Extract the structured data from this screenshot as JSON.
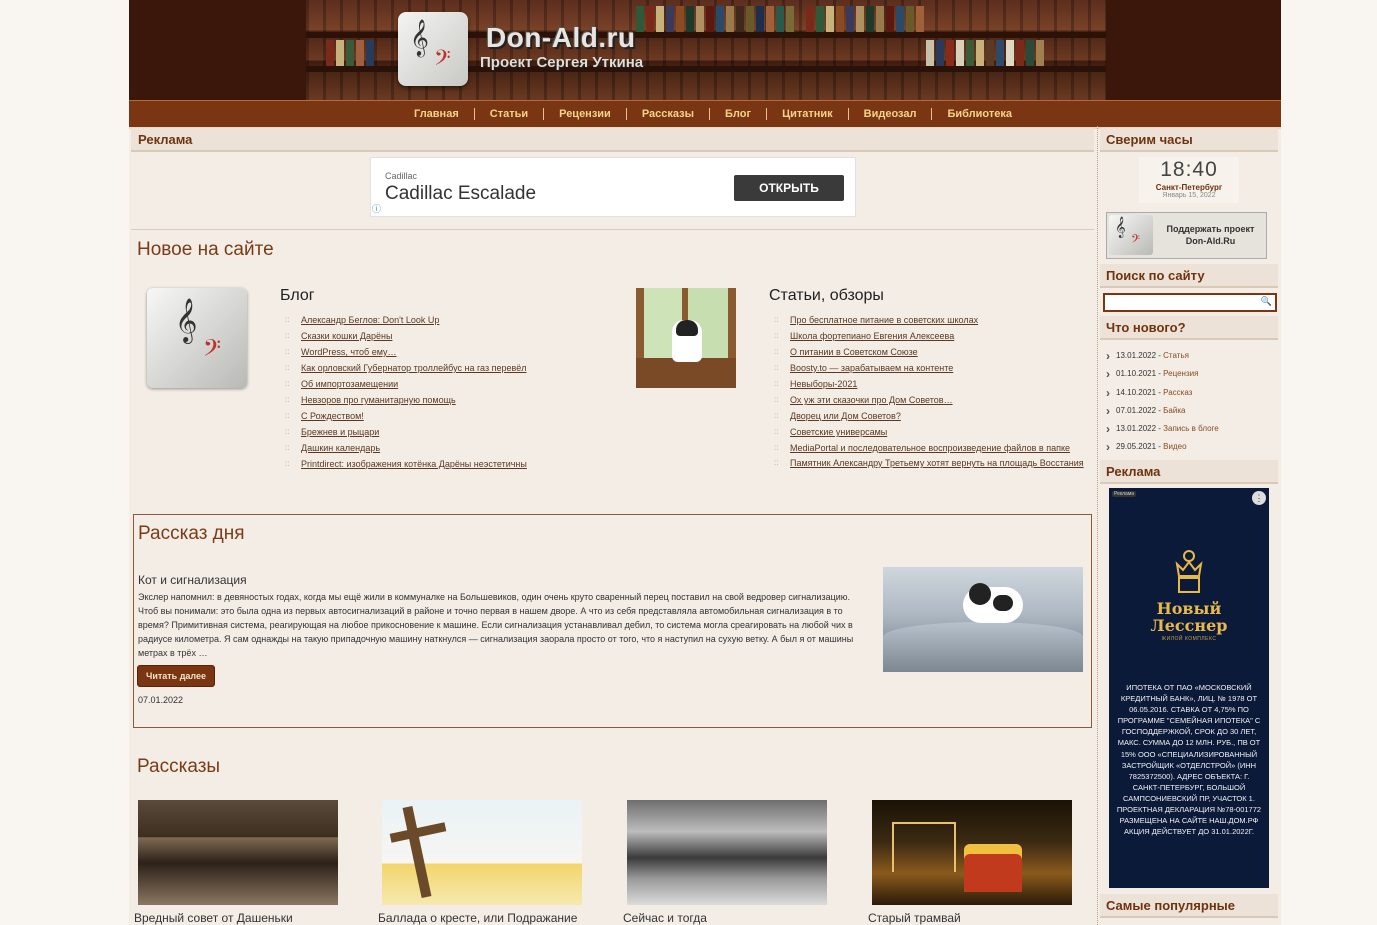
{
  "header": {
    "site_title": "Don-Ald.ru",
    "site_subtitle": "Проект Сергея Уткина"
  },
  "nav": [
    "Главная",
    "Статьи",
    "Рецензии",
    "Рассказы",
    "Блог",
    "Цитатник",
    "Видеозал",
    "Библиотека"
  ],
  "ad_top": {
    "heading": "Реклама",
    "brand": "Cadillac",
    "title": "Cadillac Escalade",
    "button": "ОТКРЫТЬ"
  },
  "new_section": {
    "title": "Новое на сайте",
    "blog": {
      "title": "Блог",
      "items": [
        "Александр Беглов: Don't Look Up",
        "Сказки кошки Дарёны",
        "WordPress, чтоб ему…",
        "Как орловский Губернатор троллейбус на газ перевёл",
        "Об импортозамещении",
        "Невзоров про гуманитарную помощь",
        "С Рождеством!",
        "Брежнев и рыцари",
        "Дашкин календарь",
        "Printdirect: изображения котёнка Дарёны неэстетичны"
      ]
    },
    "articles": {
      "title": "Статьи, обзоры",
      "items": [
        "Про бесплатное питание в советских школах",
        "Школа фортепиано Евгения Алексеева",
        "О питании в Советском Союзе",
        "Boosty.to — зарабатываем на контенте",
        "Невыборы-2021",
        "Ох уж эти сказочки про Дом Советов…",
        "Дворец или Дом Советов?",
        "Советские универсамы",
        "MediaPortal и последовательное воспроизведение файлов в папке",
        "Памятник Александру Третьему хотят вернуть на площадь Восстания"
      ]
    }
  },
  "story_day": {
    "section_title": "Рассказ дня",
    "title": "Кот и сигнализация",
    "text": "Экслер напомнил: в девяностых годах, когда мы ещё жили в коммуналке на Большевиков, один очень круто сваренный перец поставил на свой ведровер сигнализацию. Чтоб вы понимали: это была одна из первых автосигнализаций в районе и точно первая в нашем дворе. А что из себя представляла автомобильная сигнализация в то время? Примитивная система, реагирующая на любое прикосновение к машине. Если сигнализация устанавливал дебил, то система могла среагировать на любой чих в радиусе километра. Я сам однажды на такую припадочную машину наткнулся — сигнализация заорала просто от того, что я наступил на сухую ветку. А был я от машины метрах в трёх …",
    "button": "Читать далее",
    "date": "07.01.2022"
  },
  "stories": {
    "title": "Рассказы",
    "items": [
      "Вредный совет от Дашеньки",
      "Баллада о кресте, или Подражание",
      "Сейчас и тогда",
      "Старый трамвай"
    ]
  },
  "sidebar": {
    "clock_heading": "Сверим часы",
    "clock_time": "18:40",
    "clock_city": "Санкт-Петербург",
    "clock_date": "Январь 15, 2022",
    "donate": "Поддержать проект Don-Ald.Ru",
    "search_heading": "Поиск по сайту",
    "search_value": "",
    "whats_new_heading": "Что нового?",
    "whats_new": [
      {
        "date": "13.01.2022",
        "type": "Статья"
      },
      {
        "date": "01.10.2021",
        "type": "Рецензия"
      },
      {
        "date": "14.10.2021",
        "type": "Рассказ"
      },
      {
        "date": "07.01.2022",
        "type": "Байка"
      },
      {
        "date": "13.01.2022",
        "type": "Запись в блоге"
      },
      {
        "date": "29.05.2021",
        "type": "Видео"
      }
    ],
    "ad_heading": "Реклама",
    "ad": {
      "tag": "Реклама",
      "brand_line1": "Новый",
      "brand_line2": "Лесснер",
      "brand_sub": "ЖИЛОЙ КОМПЛЕКС",
      "text": "ИПОТЕКА ОТ ПАО «МОСКОВСКИЙ КРЕДИТНЫЙ БАНК», ЛИЦ. № 1978 ОТ 06.05.2016. СТАВКА ОТ 4,75% ПО ПРОГРАММЕ \"СЕМЕЙНАЯ ИПОТЕКА\" С ГОСПОДДЕРЖКОЙ, СРОК ДО 30 ЛЕТ, МАКС. СУММА ДО 12 МЛН. РУБ., ПВ ОТ 15% ООО «СПЕЦИАЛИЗИРОВАННЫЙ ЗАСТРОЙЩИК «ОТДЕЛСТРОЙ» (ИНН 7825372500). АДРЕС ОБЪЕКТА: Г. САНКТ-ПЕТЕРБУРГ, БОЛЬШОЙ САМПСОНИЕВСКИЙ ПР, УЧАСТОК 1. ПРОЕКТНАЯ ДЕКЛАРАЦИЯ №78-001772 РАЗМЕЩЕНА НА САЙТЕ НАШ.ДОМ.РФ АКЦИЯ ДЕЙСТВУЕТ ДО 31.01.2022Г."
    },
    "popular_heading": "Самые популярные"
  }
}
